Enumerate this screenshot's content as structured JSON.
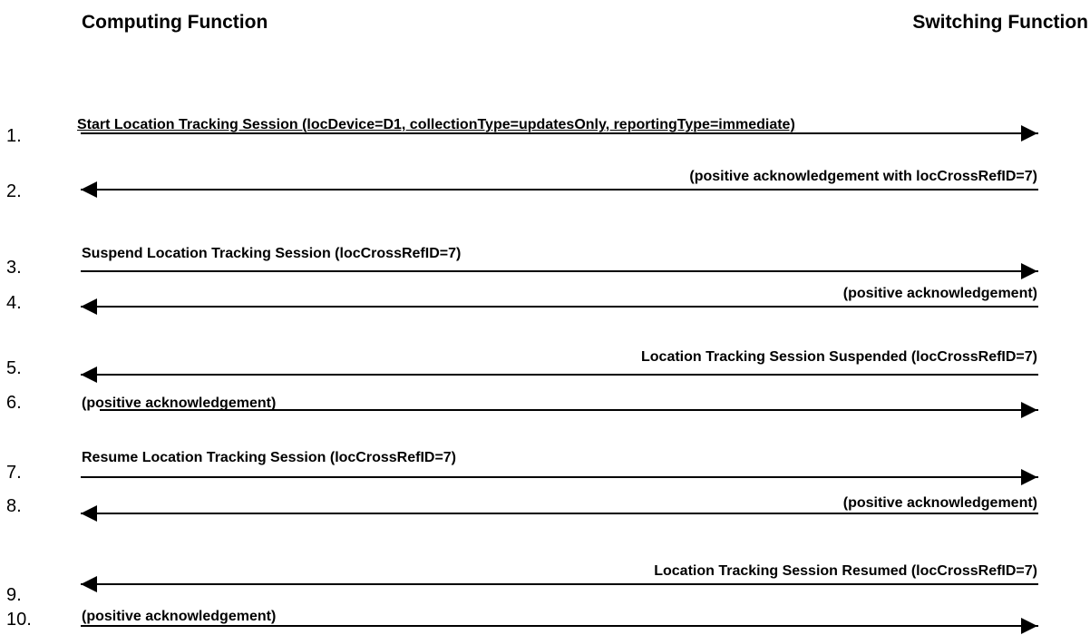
{
  "participants": {
    "left": "Computing Function",
    "right": "Switching Function"
  },
  "messages": [
    {
      "number": "1.",
      "label": "Start Location Tracking Session (locDevice=D1, collectionType=updatesOnly, reportingType=immediate)",
      "direction": "right"
    },
    {
      "number": "2.",
      "label": "(positive acknowledgement with locCrossRefID=7)",
      "direction": "left"
    },
    {
      "number": "3.",
      "label": "Suspend Location Tracking Session (locCrossRefID=7)",
      "direction": "right"
    },
    {
      "number": "4.",
      "label": "(positive acknowledgement)",
      "direction": "left"
    },
    {
      "number": "5.",
      "label": "Location Tracking Session Suspended (locCrossRefID=7)",
      "direction": "left"
    },
    {
      "number": "6.",
      "label": "(positive acknowledgement)",
      "direction": "right"
    },
    {
      "number": "7.",
      "label": "Resume Location Tracking Session (locCrossRefID=7)",
      "direction": "right"
    },
    {
      "number": "8.",
      "label": "(positive acknowledgement)",
      "direction": "left"
    },
    {
      "number": "9.",
      "label": "Location Tracking Session Resumed (locCrossRefID=7)",
      "direction": "left"
    },
    {
      "number": "10.",
      "label": "(positive acknowledgement)",
      "direction": "right"
    }
  ]
}
